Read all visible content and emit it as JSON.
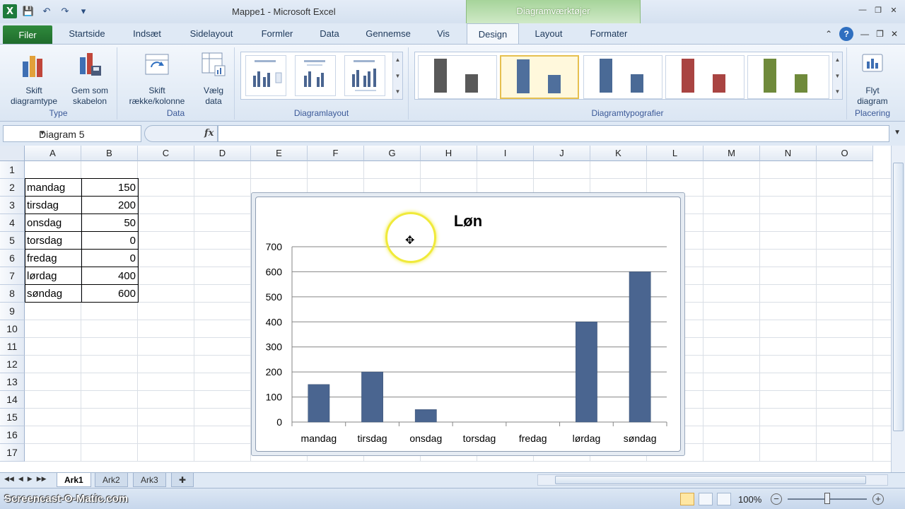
{
  "window": {
    "title": "Mappe1  -  Microsoft Excel",
    "context_tool": "Diagramværktøjer"
  },
  "tabs": [
    "Filer",
    "Startside",
    "Indsæt",
    "Sidelayout",
    "Formler",
    "Data",
    "Gennemse",
    "Vis",
    "Design",
    "Layout",
    "Formater"
  ],
  "ribbon": {
    "groups": {
      "type": "Type",
      "data": "Data",
      "layout": "Diagramlayout",
      "styles": "Diagramtypografier",
      "placement": "Placering"
    },
    "buttons": {
      "change_type_1": "Skift",
      "change_type_2": "diagramtype",
      "save_template_1": "Gem som",
      "save_template_2": "skabelon",
      "switch_1": "Skift",
      "switch_2": "række/kolonne",
      "select_data_1": "Vælg",
      "select_data_2": "data",
      "move_1": "Flyt",
      "move_2": "diagram"
    },
    "style_colors": [
      "#595959",
      "#4f6f9c",
      "#4a6a96",
      "#a94442",
      "#6f8a3b"
    ]
  },
  "formula_bar": {
    "name_box": "Diagram 5",
    "fx": "fx",
    "value": ""
  },
  "columns": [
    "A",
    "B",
    "C",
    "D",
    "E",
    "F",
    "G",
    "H",
    "I",
    "J",
    "K",
    "L",
    "M",
    "N",
    "O"
  ],
  "rows": [
    "1",
    "2",
    "3",
    "4",
    "5",
    "6",
    "7",
    "8",
    "9",
    "10",
    "11",
    "12",
    "13",
    "14",
    "15",
    "16",
    "17"
  ],
  "cells": [
    {
      "label": "mandag",
      "value": "150"
    },
    {
      "label": "tirsdag",
      "value": "200"
    },
    {
      "label": "onsdag",
      "value": "50"
    },
    {
      "label": "torsdag",
      "value": "0"
    },
    {
      "label": "fredag",
      "value": "0"
    },
    {
      "label": "lørdag",
      "value": "400"
    },
    {
      "label": "søndag",
      "value": "600"
    }
  ],
  "chart_data": {
    "type": "bar",
    "title": "Løn",
    "categories": [
      "mandag",
      "tirsdag",
      "onsdag",
      "torsdag",
      "fredag",
      "lørdag",
      "søndag"
    ],
    "values": [
      150,
      200,
      50,
      0,
      0,
      400,
      600
    ],
    "ylim": [
      0,
      700
    ],
    "yticks": [
      0,
      100,
      200,
      300,
      400,
      500,
      600,
      700
    ],
    "bar_color": "#4a6590",
    "grid": true
  },
  "sheets": [
    "Ark1",
    "Ark2",
    "Ark3"
  ],
  "status": {
    "watermark": "Screencast-O-Matic.com",
    "zoom": "100%"
  }
}
